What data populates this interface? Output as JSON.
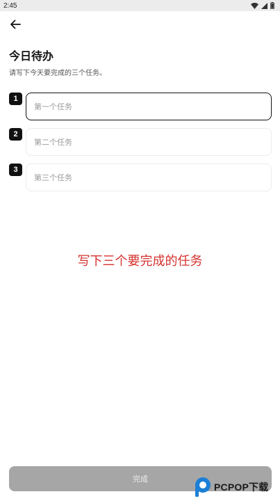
{
  "status_bar": {
    "time": "2:45"
  },
  "header": {
    "title": "今日待办",
    "subtitle": "请写下今天要完成的三个任务。"
  },
  "tasks": [
    {
      "number": "1",
      "placeholder": "第一个任务",
      "value": ""
    },
    {
      "number": "2",
      "placeholder": "第二个任务",
      "value": ""
    },
    {
      "number": "3",
      "placeholder": "第三个任务",
      "value": ""
    }
  ],
  "hint": "写下三个要完成的任务",
  "footer": {
    "done_label": "完成"
  },
  "watermark": {
    "logo_text": "PCPOP下载"
  },
  "colors": {
    "hint": "#d5322f",
    "button_disabled": "#a6a6a6",
    "badge": "#111111"
  }
}
